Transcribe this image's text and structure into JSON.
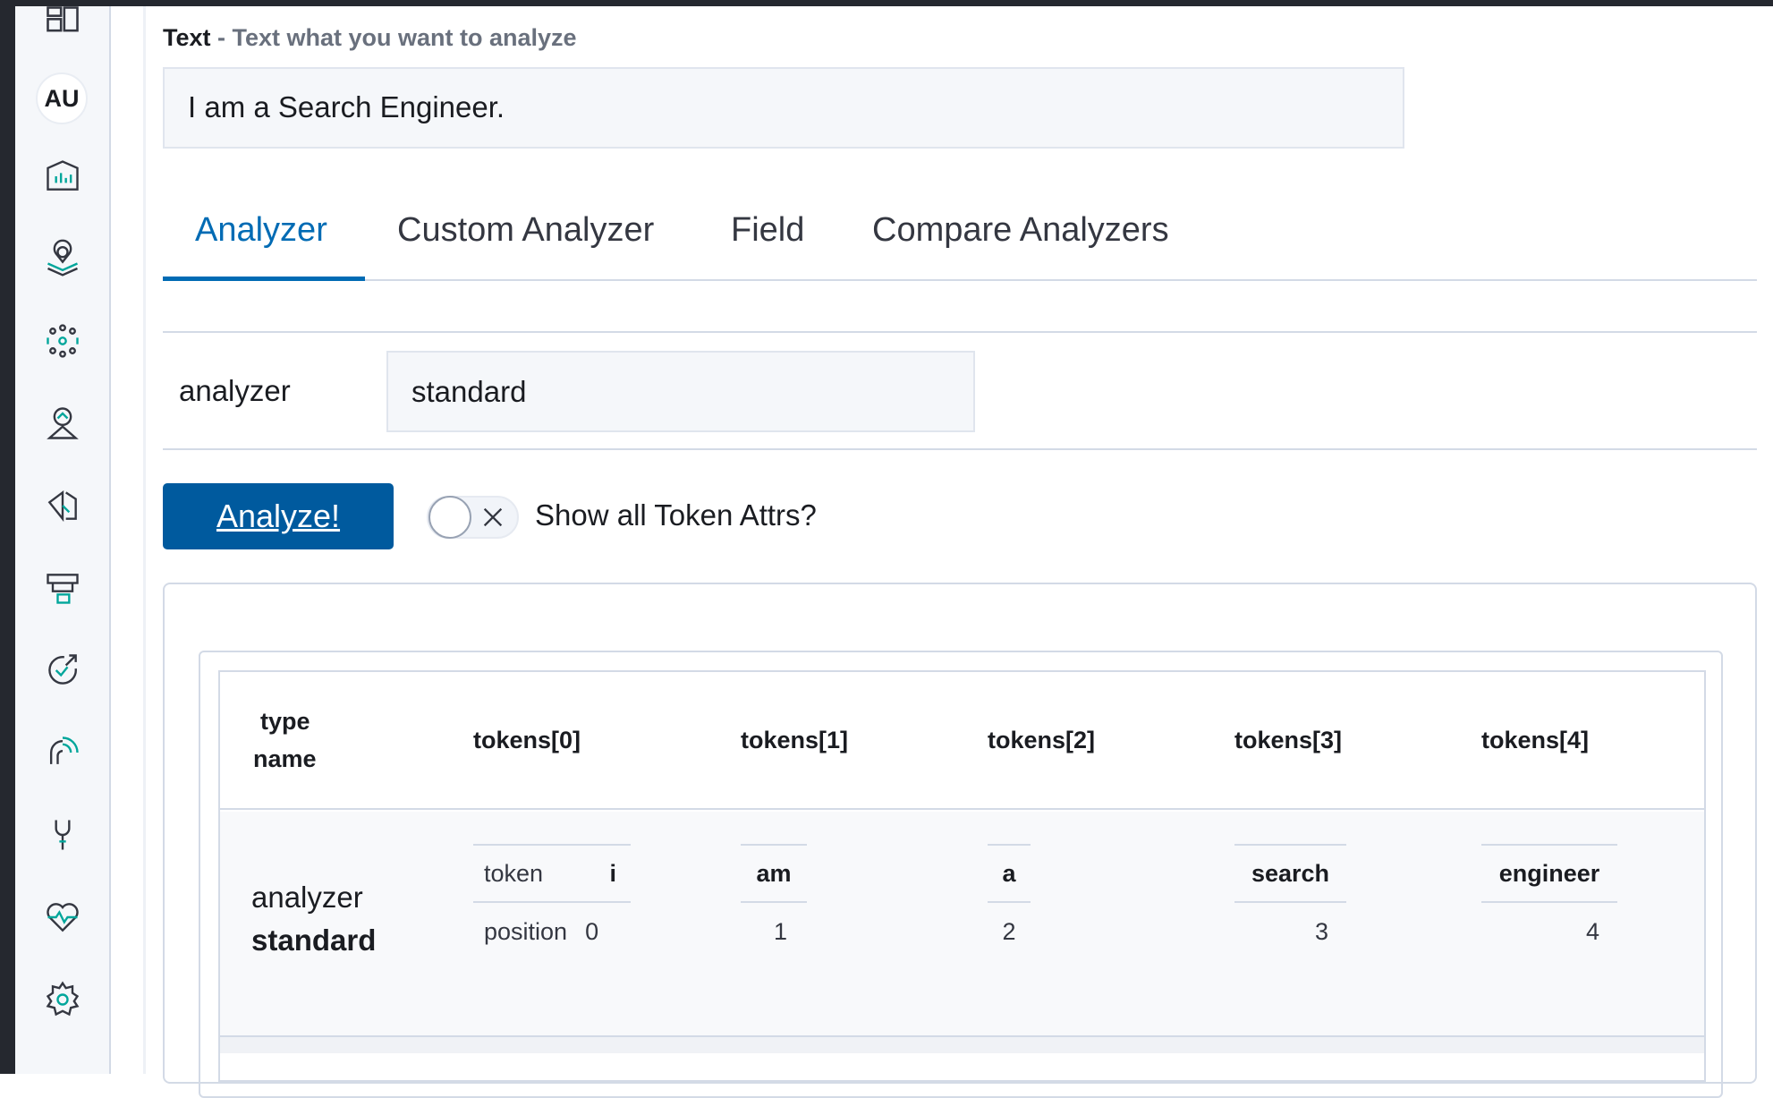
{
  "sidebar": {
    "avatar": "AU",
    "icons": [
      "dashboard-icon",
      "canvas-icon",
      "maps-icon",
      "ml-icon",
      "graph-icon",
      "apm-icon",
      "uptime-icon",
      "siem-icon",
      "observability-icon",
      "dev-tools-icon",
      "monitoring-icon",
      "management-icon"
    ]
  },
  "text_field": {
    "label": "Text",
    "help": " - Text what you want to analyze",
    "value": "I am a Search Engineer."
  },
  "tabs": [
    {
      "label": "Analyzer",
      "active": true
    },
    {
      "label": "Custom Analyzer",
      "active": false
    },
    {
      "label": "Field",
      "active": false
    },
    {
      "label": "Compare Analyzers",
      "active": false
    }
  ],
  "analyzer_row": {
    "label": "analyzer",
    "value": "standard"
  },
  "actions": {
    "analyze_label": "Analyze!",
    "toggle_label": "Show all Token Attrs?",
    "toggle_on": false
  },
  "results": {
    "headers": {
      "type_line1": "type",
      "type_line2": "name",
      "tok0": "tokens[0]",
      "tok1": "tokens[1]",
      "tok2": "tokens[2]",
      "tok3": "tokens[3]",
      "tok4": "tokens[4]"
    },
    "row": {
      "type": "analyzer",
      "name": "standard",
      "token_key": "token",
      "position_key": "position",
      "tokens": [
        {
          "token": "i",
          "position": "0"
        },
        {
          "token": "am",
          "position": "1"
        },
        {
          "token": "a",
          "position": "2"
        },
        {
          "token": "search",
          "position": "3"
        },
        {
          "token": "engineer",
          "position": "4"
        }
      ]
    }
  }
}
